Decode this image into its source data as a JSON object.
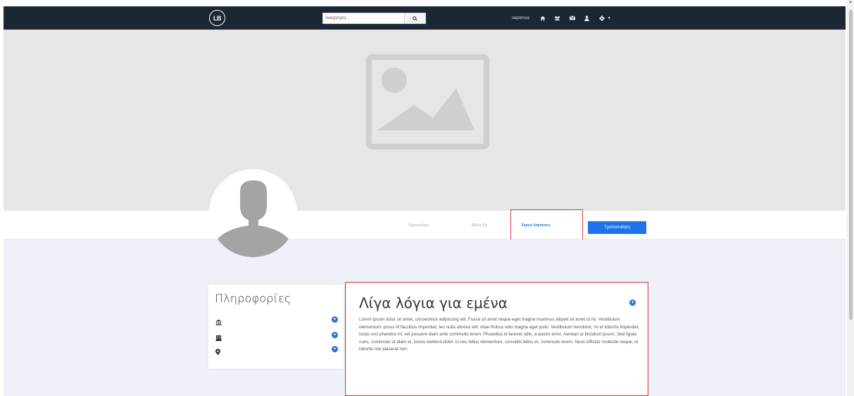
{
  "navbar": {
    "logo_text": "LB",
    "search_placeholder": "Αναζήτηση...",
    "username": "seporova",
    "icons": [
      "home-icon",
      "users-icon",
      "envelope-icon",
      "user-icon",
      "gear-icon"
    ]
  },
  "profile": {
    "tabs": [
      {
        "label": "Χρονολόγιο",
        "active": false
      },
      {
        "label": "Φίλοι (0)",
        "active": false
      },
      {
        "label": "Tanya Seporova",
        "active": true
      }
    ],
    "edit_button": "Τροποποίηση"
  },
  "info": {
    "title": "Πληροφορίες",
    "rows": [
      {
        "icon": "institution-icon",
        "value": ""
      },
      {
        "icon": "building-icon",
        "value": ""
      },
      {
        "icon": "map-marker-icon",
        "value": ""
      }
    ]
  },
  "about": {
    "title": "Λίγα λόγια για εμένα",
    "text": "Lorem ipsum dolor sit amet, consectetur adipiscing elit. Fusce sit amet neque eget magna maximus aliquet sit amet id mi. Vestibulum elementum, purus id faucibus imperdiet, leo nulla ultrices elit, vitae finibus odio magna eget justo. Vestibulum hendrerit, mi et lobortis imperdiet, turpis orci pharetra mi, vel posuere diam ante commodo lorem. Phasellus id laoreet odio, a auctor enim. Aenean ut tincidunt ipsum. Sed ligula nunc, commodo ut diam et, luctus eleifend dolor. In nec tellus elementum, convallis tellus et, commodo lorem. Nunc efficitur molestie neque, id lobortis nisl placerat non."
  },
  "colors": {
    "navbar_bg": "#1c2733",
    "accent": "#1e73e8",
    "highlight": "#d9404b",
    "cover_bg": "#e6e6e6",
    "page_bg": "#eef2f8"
  }
}
